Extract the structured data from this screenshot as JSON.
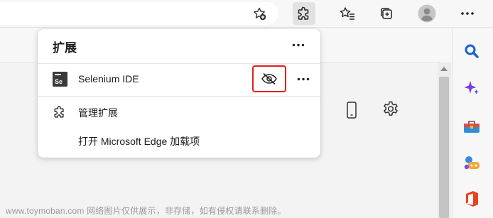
{
  "toolbar": {
    "favorites_add_icon": "star-add-icon",
    "extensions_icon": "puzzle-icon",
    "favorites_icon": "star-list-icon",
    "collections_icon": "collections-icon",
    "profile_icon": "avatar-icon",
    "more_icon": "ellipsis-icon"
  },
  "panel": {
    "title": "扩展",
    "extensions": [
      {
        "name": "Selenium IDE",
        "logo_text": "Se"
      }
    ],
    "menu": [
      {
        "label": "管理扩展",
        "icon": "puzzle-icon"
      },
      {
        "label": "打开 Microsoft Edge 加载项"
      }
    ]
  },
  "sidebar": {
    "items": [
      "search-icon",
      "copilot-icon",
      "toolbox-icon",
      "games-icon",
      "office-icon"
    ]
  },
  "watermark": "www.toymoban.com 网络图片仅供展示，非存储，如有侵权请联系删除。",
  "colors": {
    "highlight": "#e0201c",
    "search": "#1b5fd1",
    "copilot": "#7c3aed"
  }
}
